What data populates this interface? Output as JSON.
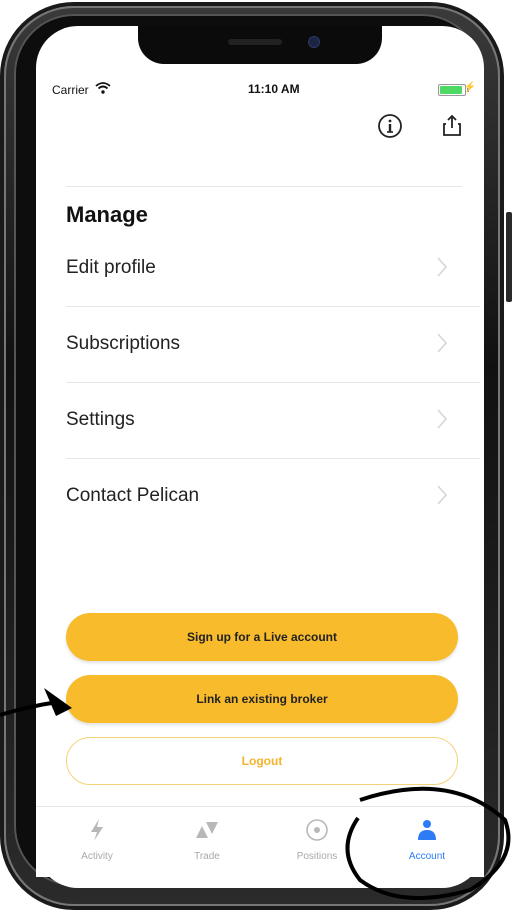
{
  "status_bar": {
    "carrier": "Carrier",
    "time": "11:10 AM"
  },
  "header": {
    "icons": [
      "info-icon",
      "share-icon"
    ]
  },
  "manage": {
    "title": "Manage",
    "items": [
      {
        "label": "Edit profile"
      },
      {
        "label": "Subscriptions"
      },
      {
        "label": "Settings"
      },
      {
        "label": "Contact Pelican"
      }
    ]
  },
  "actions": {
    "signup_label": "Sign up for a Live account",
    "link_broker_label": "Link an existing broker",
    "logout_label": "Logout"
  },
  "tabbar": {
    "tabs": [
      {
        "label": "Activity",
        "icon": "bolt-icon"
      },
      {
        "label": "Trade",
        "icon": "trade-icon"
      },
      {
        "label": "Positions",
        "icon": "target-icon"
      },
      {
        "label": "Account",
        "icon": "person-icon",
        "active": true
      }
    ]
  },
  "colors": {
    "accent": "#f8bb2c",
    "tab_active": "#2d7cf6",
    "tab_inactive": "#a8a8a8"
  }
}
